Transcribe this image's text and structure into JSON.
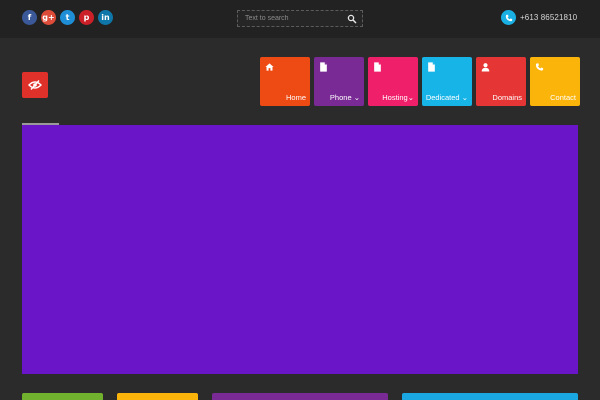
{
  "topbar": {
    "social": [
      {
        "name": "facebook",
        "glyph": "f",
        "color": "#3b5998"
      },
      {
        "name": "google-plus",
        "glyph": "g+",
        "color": "#dd4b39"
      },
      {
        "name": "twitter",
        "glyph": "t",
        "color": "#1e8fd6"
      },
      {
        "name": "pinterest",
        "glyph": "p",
        "color": "#cb2027"
      },
      {
        "name": "linkedin",
        "glyph": "in",
        "color": "#0e76a8"
      }
    ],
    "search": {
      "placeholder": "Text to search",
      "icon": "search-icon"
    },
    "phone": {
      "number": "+613 86521810",
      "icon": "phone-icon",
      "color": "#1ab0e4"
    }
  },
  "logo": {
    "icon": "eye-slash-icon",
    "color": "#e0302a"
  },
  "nav": {
    "items": [
      {
        "label": "Home",
        "icon": "home-icon",
        "color": "#ee4a14",
        "dropdown": false
      },
      {
        "label": "Phone",
        "icon": "file-icon",
        "color": "#7a2a94",
        "dropdown": true
      },
      {
        "label": "Hosting",
        "icon": "file-icon",
        "color": "#ef1f6a",
        "dropdown": true
      },
      {
        "label": "Dedicated",
        "icon": "file-icon",
        "color": "#17b4e8",
        "dropdown": true
      },
      {
        "label": "Domains",
        "icon": "user-icon",
        "color": "#e53535",
        "dropdown": false
      },
      {
        "label": "Contact",
        "icon": "phone-icon",
        "color": "#fbb40a",
        "dropdown": false
      }
    ],
    "dropdown_glyph": "⌄"
  },
  "slider": {
    "color": "#6b15c8"
  },
  "tiles": [
    {
      "color": "#70b22e"
    },
    {
      "color": "#fbb40a"
    },
    {
      "color": "#7a2a94"
    },
    {
      "color": "#1aa6e0"
    }
  ]
}
